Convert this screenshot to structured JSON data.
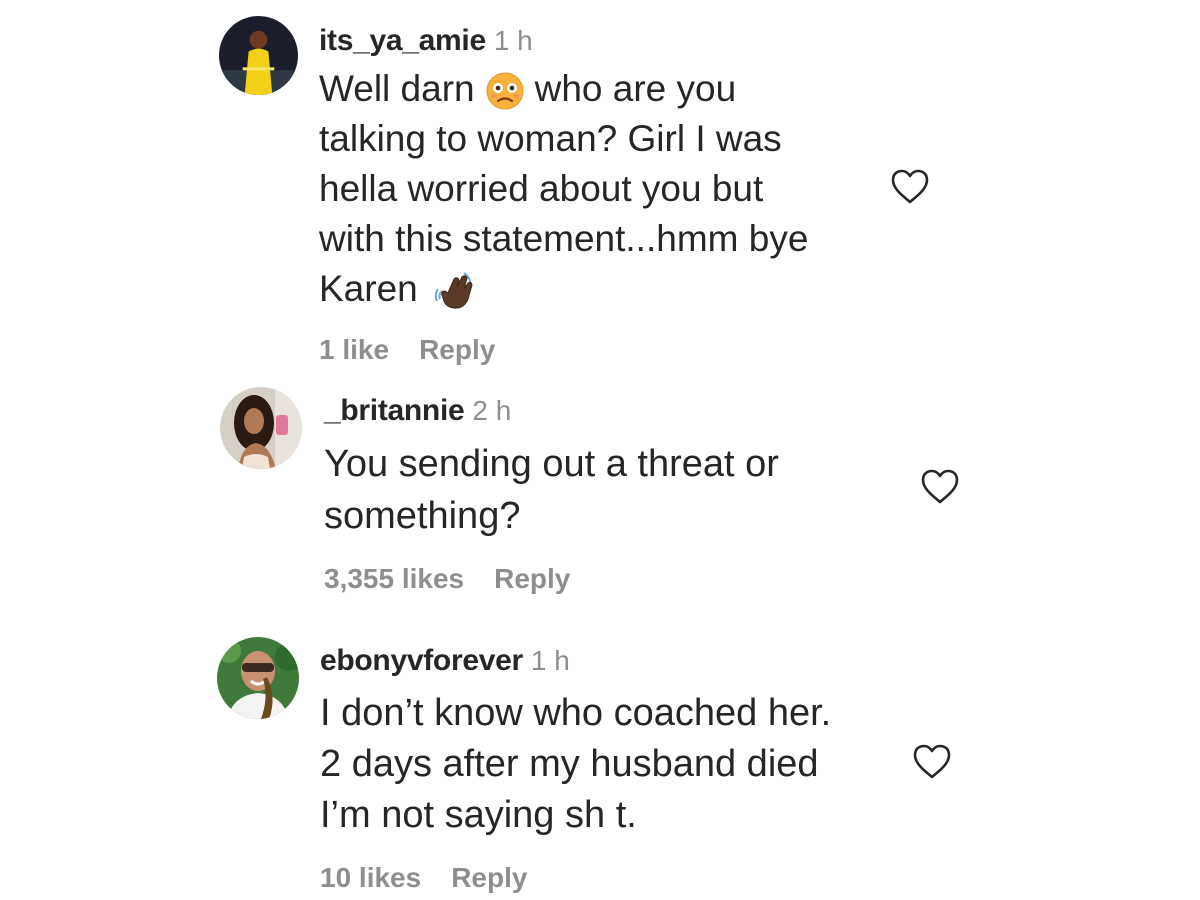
{
  "comments": [
    {
      "username": "its_ya_amie",
      "time": "1 h",
      "lines": [
        "Well darn",
        "who are you",
        "talking to woman? Girl I was",
        "hella worried about you but",
        "with this statement...hmm bye",
        "Karen"
      ],
      "emoji_1": "confused-face-emoji",
      "emoji_2": "waving-hand-emoji",
      "likes": "1 like",
      "reply": "Reply"
    },
    {
      "username": "_britannie",
      "time": "2 h",
      "lines": [
        "You sending out a threat or",
        "something?"
      ],
      "likes": "3,355 likes",
      "reply": "Reply"
    },
    {
      "username": "ebonyvforever",
      "time": "1 h",
      "lines": [
        "I don’t know who coached her.",
        "2 days after my husband died",
        "I’m not saying sh t."
      ],
      "likes": "10 likes",
      "reply": "Reply"
    }
  ],
  "icons": {
    "like": "heart-outline-icon"
  },
  "colors": {
    "text": "#262626",
    "muted": "#8e8e8e",
    "background": "#ffffff"
  }
}
